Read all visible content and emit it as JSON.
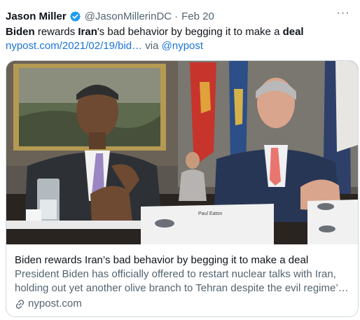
{
  "tweet": {
    "author_name": "Jason Miller",
    "author_handle": "@JasonMillerinDC",
    "separator": "·",
    "date": "Feb 20",
    "more_label": "···",
    "text": {
      "p1": "Biden",
      "p2": " rewards ",
      "p3": "Iran",
      "p4": "'s bad behavior by begging it to make a ",
      "p5": "deal"
    },
    "link_url": "nypost.com/2021/02/19/bid…",
    "via_text": " via ",
    "via_handle": "@nypost"
  },
  "card": {
    "title": "Biden rewards Iran’s bad behavior by begging it to make a deal",
    "description": "President Biden has officially offered to restart nuclear talks with Iran, holding out yet another olive branch to Tehran despite the evil regime’…",
    "domain": "nypost.com",
    "placard_text": "Paul Eaton",
    "link_icon": "link-icon",
    "verified_icon": "verified-badge-icon"
  },
  "colors": {
    "link_blue": "#1b74d6",
    "verified_blue": "#1d9bf0",
    "secondary_text": "#536471",
    "card_border": "#cfd9de"
  }
}
